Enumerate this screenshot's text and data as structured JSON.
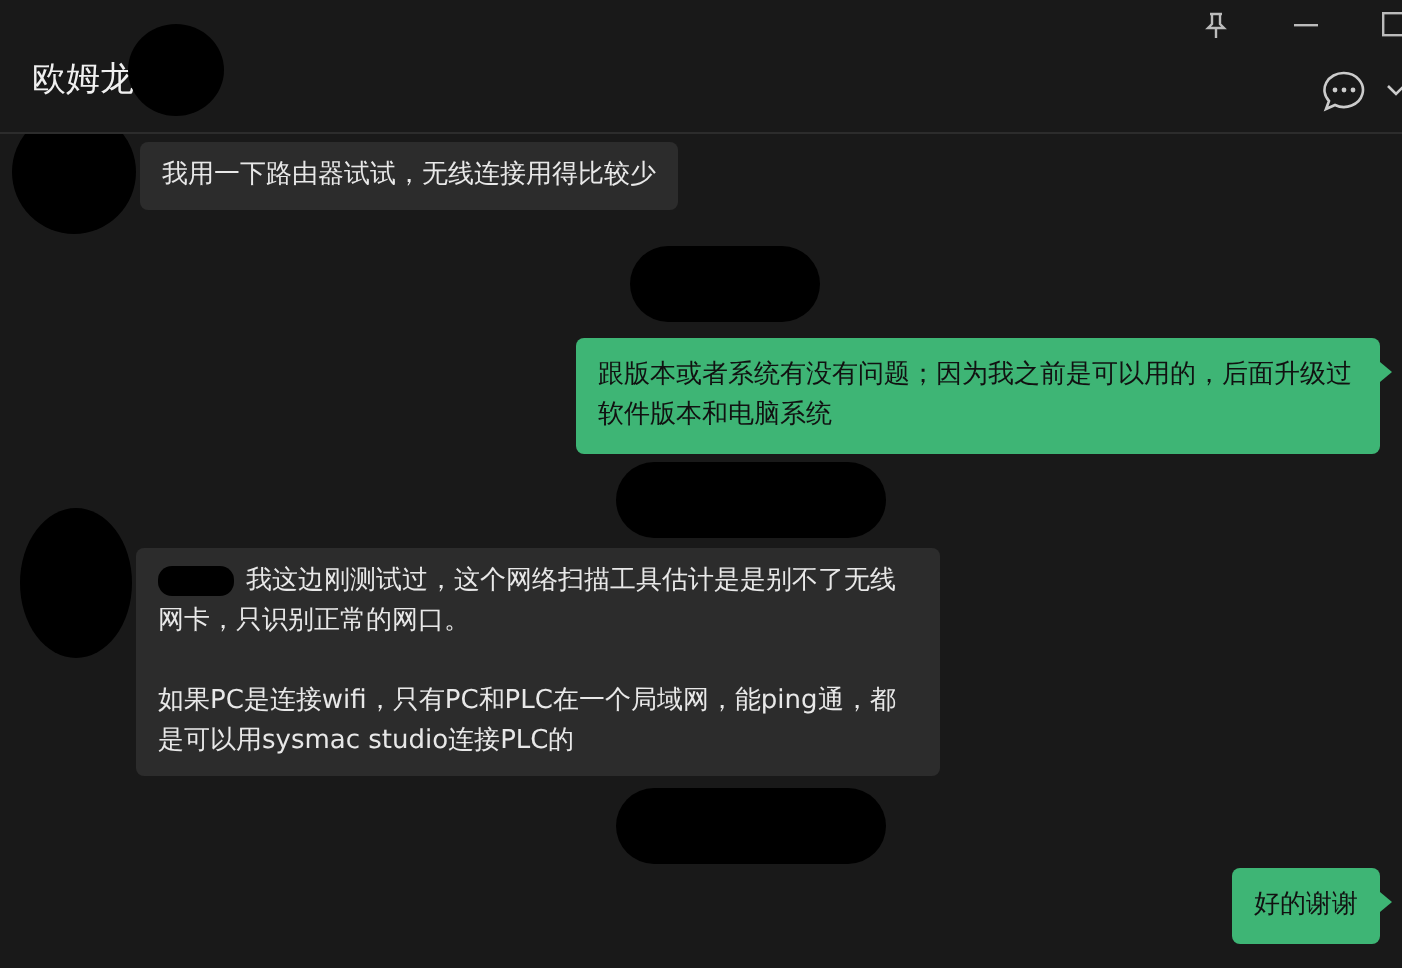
{
  "header": {
    "title": "欧姆龙",
    "title_redacted": true
  },
  "messages": [
    {
      "kind": "in",
      "text": "我用一下路由器试试，无线连接用得比较少",
      "mention_redacted": false
    },
    {
      "kind": "time"
    },
    {
      "kind": "out",
      "text": "跟版本或者系统有没有问题；因为我之前是可以用的，后面升级过软件版本和电脑系统"
    },
    {
      "kind": "time"
    },
    {
      "kind": "in",
      "text": "我这边刚测试过，这个网络扫描工具估计是是别不了无线网卡，只识别正常的网口。",
      "text_2": "如果PC是连接wifi，只有PC和PLC在一个局域网，能ping通，都是可以用sysmac studio连接PLC的",
      "mention_redacted": true
    },
    {
      "kind": "time"
    },
    {
      "kind": "out",
      "text": "好的谢谢"
    }
  ]
}
